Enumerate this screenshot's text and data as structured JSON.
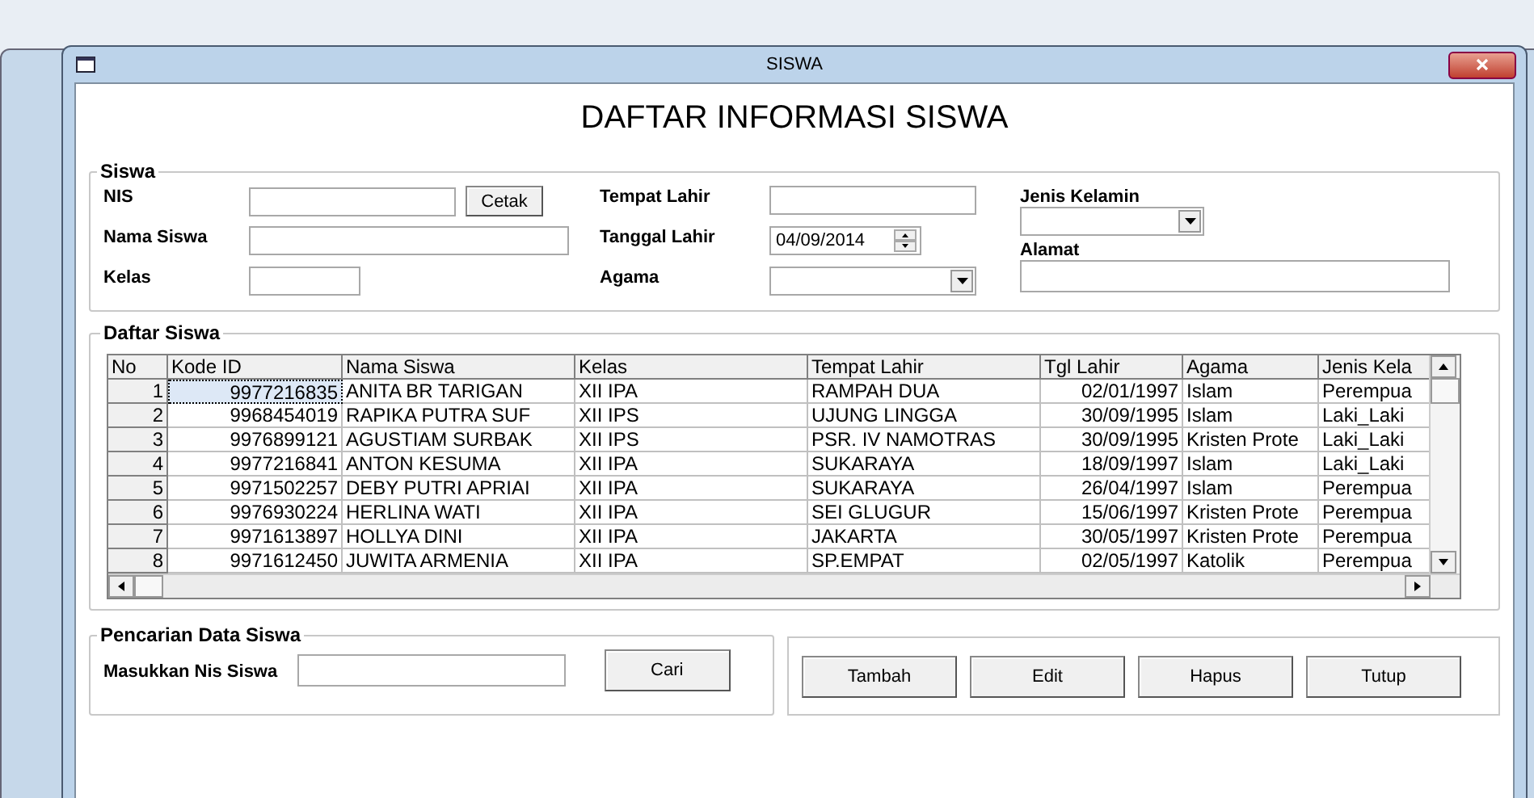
{
  "window": {
    "title": "SISWA"
  },
  "heading": "DAFTAR INFORMASI SISWA",
  "siswa": {
    "title": "Siswa",
    "columns": [
      [
        {
          "label": "NIS",
          "kind": "text",
          "button": "Cetak"
        },
        {
          "label": "Nama Siswa",
          "kind": "text"
        },
        {
          "label": "Kelas",
          "kind": "text"
        }
      ],
      [
        {
          "label": "Tempat Lahir",
          "kind": "text"
        },
        {
          "label": "Tanggal Lahir",
          "kind": "date",
          "value": "04/09/2014"
        },
        {
          "label": "Agama",
          "kind": "combo"
        }
      ],
      [
        {
          "label": "Jenis Kelamin",
          "kind": "combo"
        },
        {
          "label": "Alamat",
          "kind": "text"
        }
      ]
    ]
  },
  "daftar": {
    "title": "Daftar Siswa",
    "columns": [
      "No",
      "Kode ID",
      "Nama Siswa",
      "Kelas",
      "Tempat Lahir",
      "Tgl Lahir",
      "Agama",
      "Jenis Kela"
    ],
    "rows": [
      {
        "selected": true,
        "cells": [
          "1",
          "9977216835",
          "ANITA BR TARIGAN",
          "XII IPA",
          "RAMPAH DUA",
          "02/01/1997",
          "Islam",
          "Perempua"
        ]
      },
      {
        "selected": false,
        "cells": [
          "2",
          "9968454019",
          "RAPIKA PUTRA SUF",
          "XII IPS",
          "UJUNG LINGGA",
          "30/09/1995",
          "Islam",
          "Laki_Laki"
        ]
      },
      {
        "selected": false,
        "cells": [
          "3",
          "9976899121",
          "AGUSTIAM SURBAK",
          "XII IPS",
          "PSR. IV NAMOTRAS",
          "30/09/1995",
          "Kristen Prote",
          "Laki_Laki"
        ]
      },
      {
        "selected": false,
        "cells": [
          "4",
          "9977216841",
          "ANTON KESUMA",
          "XII IPA",
          "SUKARAYA",
          "18/09/1997",
          "Islam",
          "Laki_Laki"
        ]
      },
      {
        "selected": false,
        "cells": [
          "5",
          "9971502257",
          "DEBY PUTRI APRIAI",
          "XII IPA",
          "SUKARAYA",
          "26/04/1997",
          "Islam",
          "Perempua"
        ]
      },
      {
        "selected": false,
        "cells": [
          "6",
          "9976930224",
          "HERLINA WATI",
          "XII IPA",
          "SEI GLUGUR",
          "15/06/1997",
          "Kristen Prote",
          "Perempua"
        ]
      },
      {
        "selected": false,
        "cells": [
          "7",
          "9971613897",
          "HOLLYA DINI",
          "XII IPA",
          "JAKARTA",
          "30/05/1997",
          "Kristen Prote",
          "Perempua"
        ]
      },
      {
        "selected": false,
        "cells": [
          "8",
          "9971612450",
          "JUWITA ARMENIA",
          "XII IPA",
          "SP.EMPAT",
          "02/05/1997",
          "Katolik",
          "Perempua"
        ]
      }
    ]
  },
  "pencarian": {
    "title": "Pencarian Data Siswa",
    "label": "Masukkan Nis Siswa",
    "button": "Cari"
  },
  "buttons": [
    "Tambah",
    "Edit",
    "Hapus",
    "Tutup"
  ]
}
